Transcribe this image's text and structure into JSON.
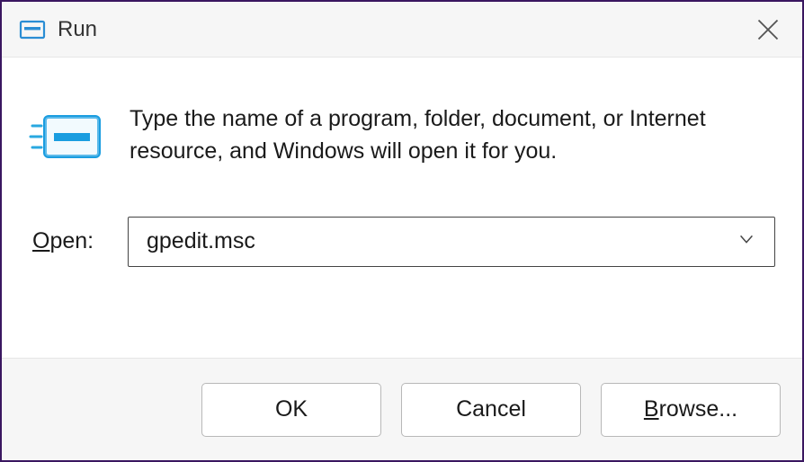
{
  "titlebar": {
    "title": "Run"
  },
  "content": {
    "description": "Type the name of a program, folder, document, or Internet resource, and Windows will open it for you.",
    "open_label_prefix": "O",
    "open_label_rest": "pen:",
    "input_value": "gpedit.msc"
  },
  "buttons": {
    "ok": "OK",
    "cancel": "Cancel",
    "browse_prefix": "B",
    "browse_rest": "rowse..."
  }
}
